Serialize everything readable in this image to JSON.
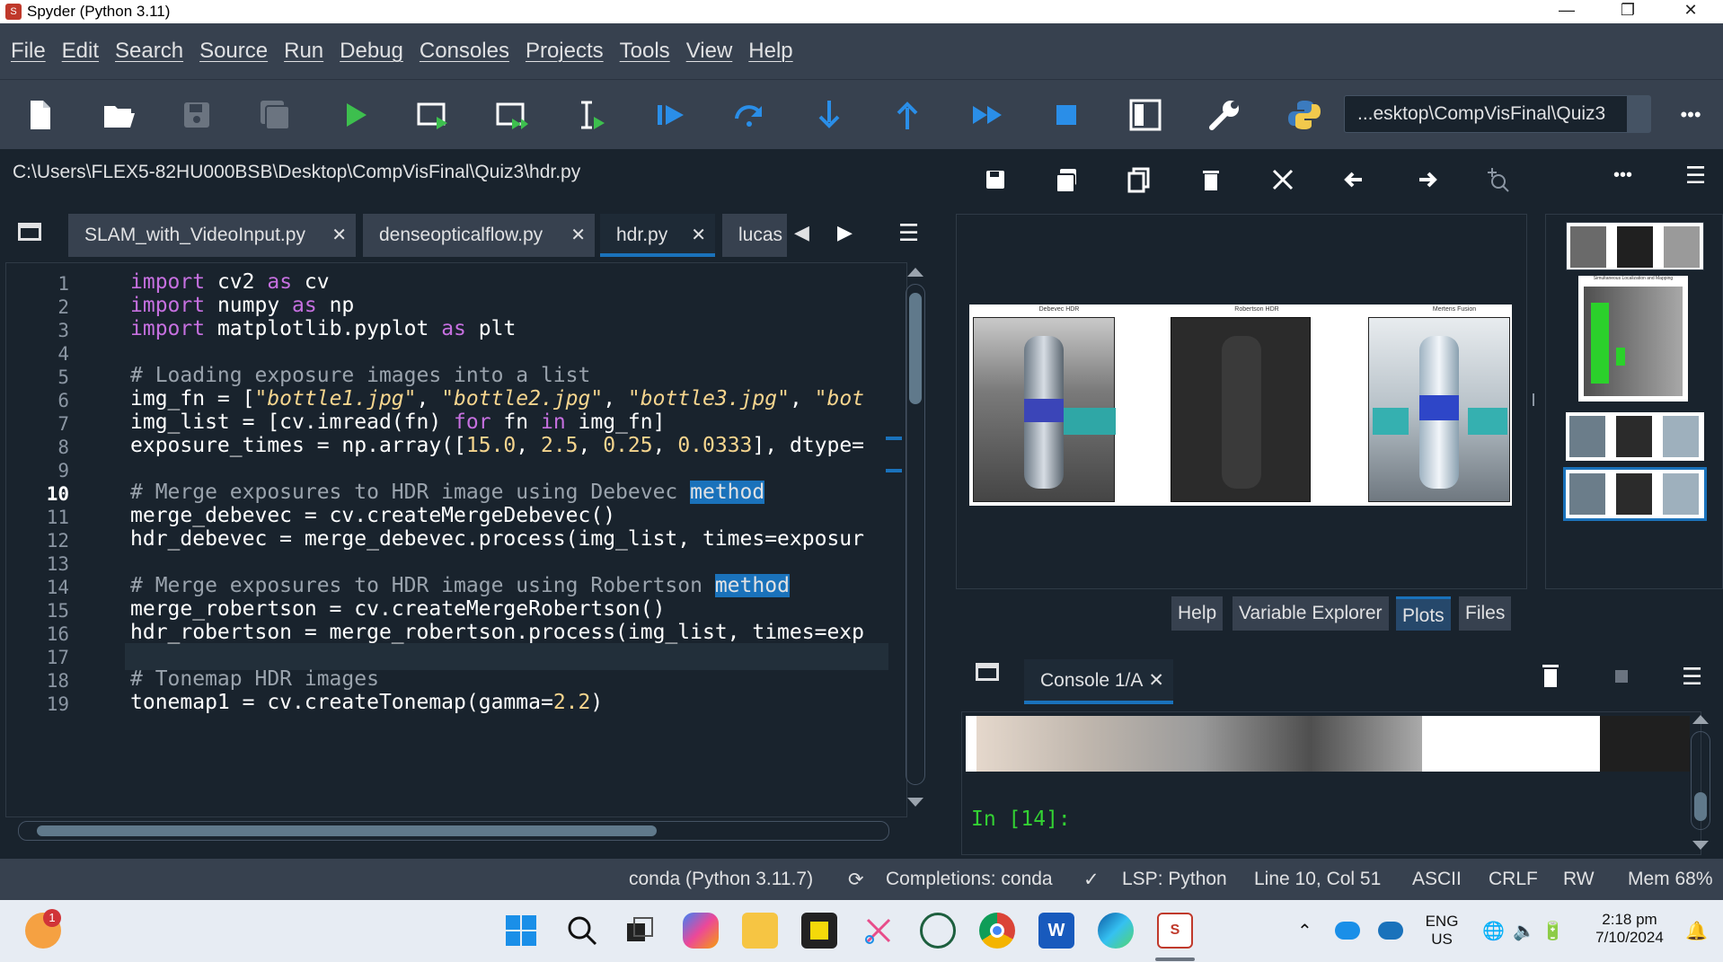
{
  "window": {
    "title": "Spyder (Python 3.11)",
    "controls": {
      "minimize": "—",
      "maximize": "❐",
      "close": "✕"
    }
  },
  "menu": [
    "File",
    "Edit",
    "Search",
    "Source",
    "Run",
    "Debug",
    "Consoles",
    "Projects",
    "Tools",
    "View",
    "Help"
  ],
  "toolbar": {
    "working_dir": "...esktop\\CompVisFinal\\Quiz3",
    "more": "•••"
  },
  "editor": {
    "file_path": "C:\\Users\\FLEX5-82HU000BSB\\Desktop\\CompVisFinal\\Quiz3\\hdr.py",
    "tabs": [
      {
        "label": "SLAM_with_VideoInput.py",
        "close": "✕"
      },
      {
        "label": "denseopticalflow.py",
        "close": "✕"
      },
      {
        "label": "hdr.py",
        "close": "✕"
      },
      {
        "label": "lucas"
      }
    ],
    "tab_nav": {
      "prev": "◀",
      "next": "▶",
      "menu": "☰"
    },
    "current_line": 10,
    "line_numbers": [
      "1",
      "2",
      "3",
      "4",
      "5",
      "6",
      "7",
      "8",
      "9",
      "10",
      "11",
      "12",
      "13",
      "14",
      "15",
      "16",
      "17",
      "18",
      "19"
    ],
    "lines": [
      "import cv2 as cv",
      "import numpy as np",
      "import matplotlib.pyplot as plt",
      "",
      "# Loading exposure images into a list",
      "img_fn = [\"bottle1.jpg\", \"bottle2.jpg\", \"bottle3.jpg\", \"bot",
      "img_list = [cv.imread(fn) for fn in img_fn]",
      "exposure_times = np.array([15.0, 2.5, 0.25, 0.0333], dtype=",
      "",
      "# Merge exposures to HDR image using Debevec method",
      "merge_debevec = cv.createMergeDebevec()",
      "hdr_debevec = merge_debevec.process(img_list, times=exposur",
      "",
      "# Merge exposures to HDR image using Robertson method",
      "merge_robertson = cv.createMergeRobertson()",
      "hdr_robertson = merge_robertson.process(img_list, times=exp",
      "",
      "# Tonemap HDR images",
      "tonemap1 = cv.createTonemap(gamma=2.2)"
    ]
  },
  "plots": {
    "panel_titles": [
      "Debevec HDR",
      "Robertson HDR",
      "Mertens Fusion"
    ],
    "thumb_caption": "Simultaneous Localization and Mapping",
    "toolbar_more": "•••",
    "toolbar_menu": "☰"
  },
  "pane_tabs": [
    "Help",
    "Variable Explorer",
    "Plots",
    "Files"
  ],
  "console": {
    "tab_label": "Console 1/A",
    "tab_close": "✕",
    "prompt": "In [14]:",
    "menu": "☰"
  },
  "status": {
    "env": "conda (Python 3.11.7)",
    "completions": "Completions: conda",
    "lsp": "LSP: Python",
    "position": "Line 10, Col 51",
    "encoding": "ASCII",
    "eol": "CRLF",
    "perm": "RW",
    "mem": "Mem 68%"
  },
  "taskbar": {
    "notification_count": "1",
    "lang": "ENG",
    "region": "US",
    "time": "2:18 pm",
    "date": "7/10/2024"
  },
  "colors": {
    "bg": "#19232d",
    "panel": "#37414f",
    "accent": "#1a72bb",
    "run_green": "#3dbf4e",
    "debug_blue": "#2a8ee8",
    "keyword": "#c670e0",
    "string": "#f6d58e"
  }
}
